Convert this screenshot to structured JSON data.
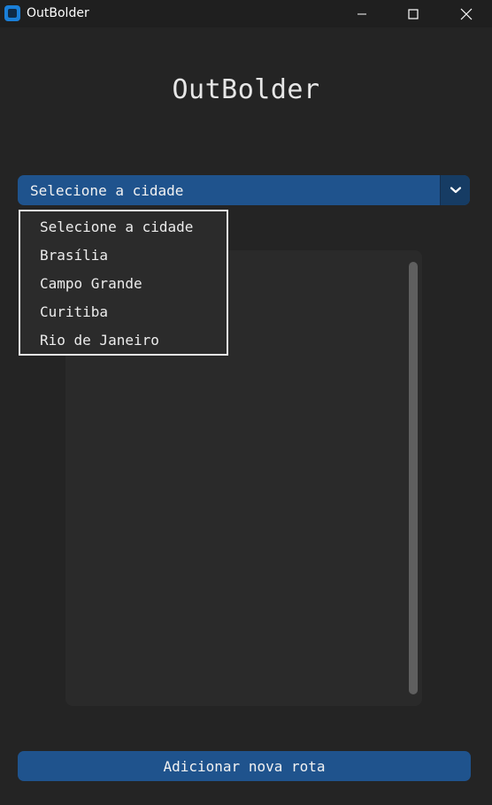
{
  "window": {
    "title": "OutBolder",
    "controls": {
      "minimize_icon": "minimize-icon",
      "maximize_icon": "maximize-icon",
      "close_icon": "close-icon"
    }
  },
  "main": {
    "heading": "OutBolder",
    "city_select": {
      "value": "Selecione a cidade",
      "arrow_icon": "chevron-down-icon",
      "options": [
        "Selecione a cidade",
        "Brasília",
        "Campo Grande",
        "Curitiba",
        "Rio de Janeiro"
      ]
    },
    "add_route_button": "Adicionar nova rota"
  },
  "colors": {
    "background": "#242424",
    "accent": "#1f538d",
    "accent_dark": "#163c64",
    "panel": "#2a2a2a"
  }
}
